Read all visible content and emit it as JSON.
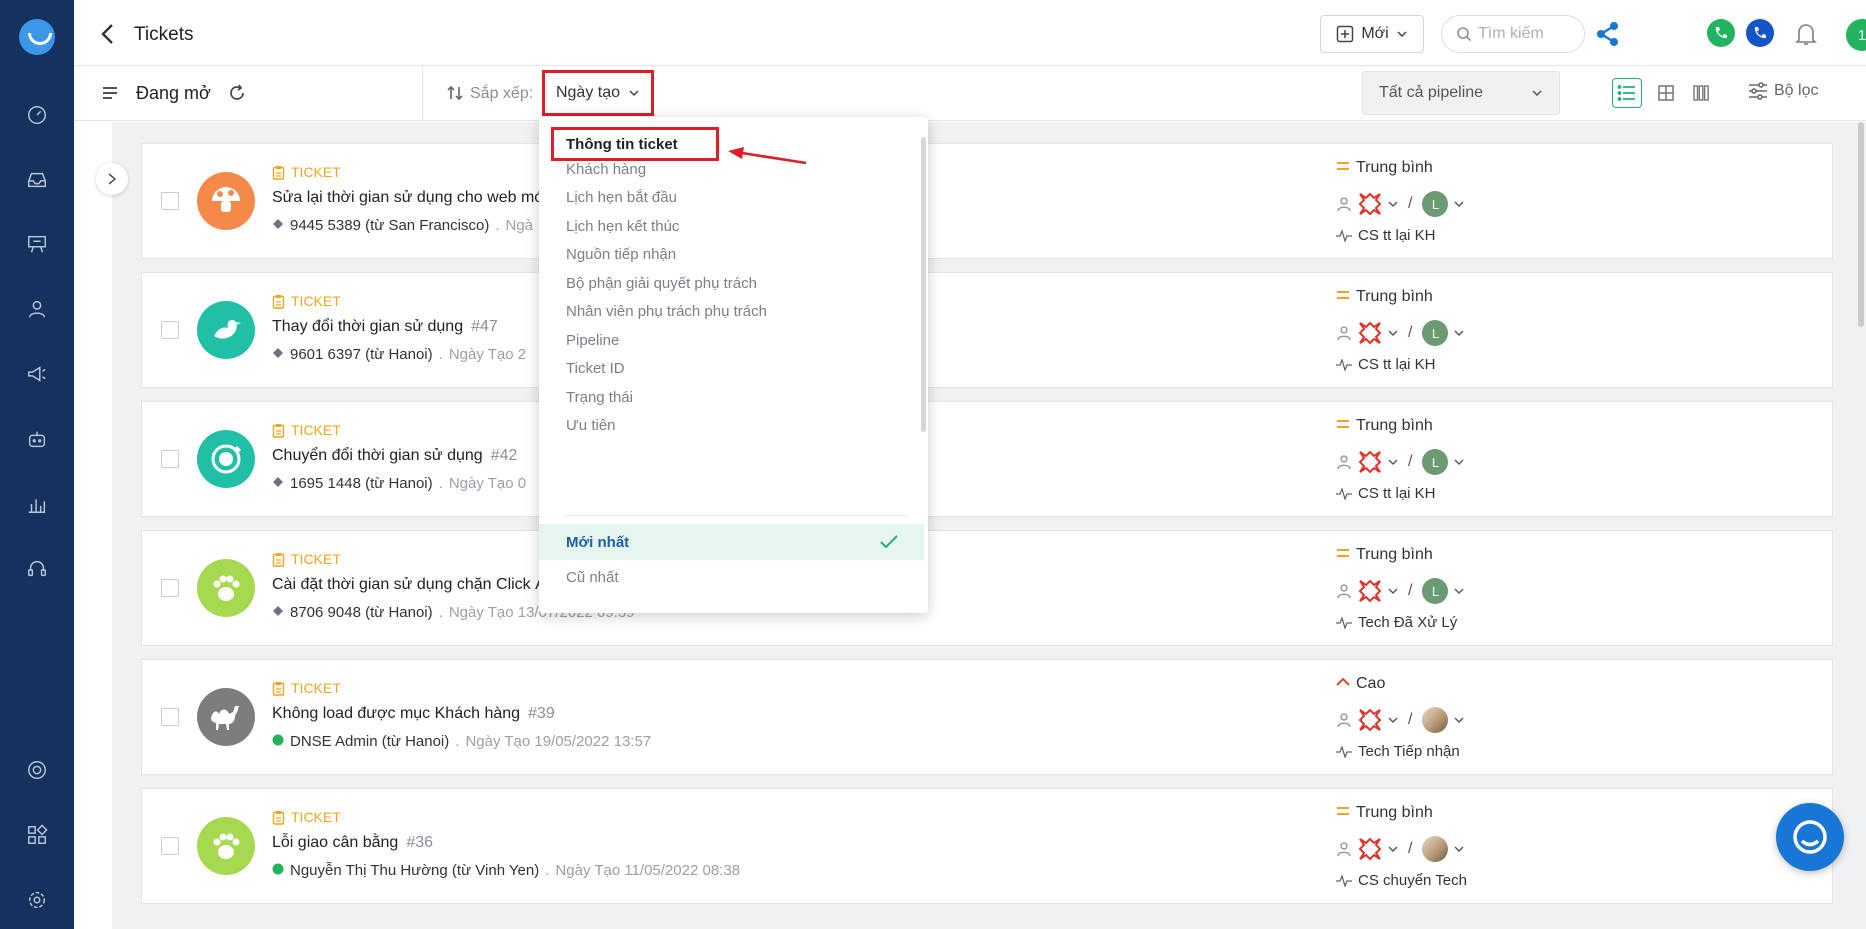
{
  "header": {
    "title": "Tickets",
    "new_label": "Mới",
    "search_placeholder": "Tìm kiếm",
    "user_badge": "1"
  },
  "toolbar": {
    "view_title": "Đang mở",
    "sort_label": "Sắp xếp:",
    "sort_value": "Ngày tạo",
    "pipeline_value": "Tất cả pipeline",
    "filter_label": "Bộ lọc"
  },
  "sort_menu": {
    "fields": [
      "Thông tin ticket",
      "Khách hàng",
      "Lịch hẹn bắt đầu",
      "Lịch hẹn kết thúc",
      "Nguồn tiếp nhận",
      "Bộ phận giải quyết phụ trách",
      "Nhân viên phụ trách phụ trách",
      "Pipeline",
      "Ticket ID",
      "Trạng thái",
      "Ưu tiên"
    ],
    "order": [
      "Mới nhất",
      "Cũ nhất"
    ]
  },
  "tickets": [
    {
      "type": "TICKET",
      "title": "Sửa lại thời gian sử dụng cho web mớ",
      "number": "",
      "meta": "9445 5389 (từ San Francisco)",
      "meta2": "Ngà",
      "priority": "Trung bình",
      "agent_initial": "L",
      "stage": "CS tt lại KH",
      "avatar_color": "#f5894a",
      "avatar_icon": "mushroom-icon",
      "source_icon": "pin-icon"
    },
    {
      "type": "TICKET",
      "title": "Thay đổi thời gian sử dụng",
      "number": "#47",
      "meta": "9601 6397 (từ Hanoi)",
      "meta2": "Ngày Tạo 2",
      "priority": "Trung bình",
      "agent_initial": "L",
      "stage": "CS tt lại KH",
      "avatar_color": "#1fc0a6",
      "avatar_icon": "bird-icon",
      "source_icon": "pin-icon"
    },
    {
      "type": "TICKET",
      "title": "Chuyển đổi thời gian sử dụng",
      "number": "#42",
      "meta": "1695 1448 (từ Hanoi)",
      "meta2": "Ngày Tạo 0",
      "priority": "Trung bình",
      "agent_initial": "L",
      "stage": "CS tt lại KH",
      "avatar_color": "#1fc0a6",
      "avatar_icon": "planet-icon",
      "source_icon": "pin-icon"
    },
    {
      "type": "TICKET",
      "title": "Cài đặt thời gian sử dụng chặn Click Ả",
      "number": "",
      "meta": "8706 9048 (từ Hanoi)",
      "meta2": "Ngày Tạo 13/07/2022 09:39",
      "priority": "Trung bình",
      "agent_initial": "L",
      "stage": "Tech Đã Xử Lý",
      "avatar_color": "#a6d94f",
      "avatar_icon": "paw-icon",
      "source_icon": "pin-icon"
    },
    {
      "type": "TICKET",
      "title": "Không load được mục Khách hàng",
      "number": "#39",
      "meta": "DNSE Admin (từ Hanoi)",
      "meta2": "Ngày Tạo 19/05/2022 13:57",
      "priority": "Cao",
      "agent_initial": "",
      "stage": "Tech Tiếp nhận",
      "avatar_color": "#7d7d7d",
      "avatar_icon": "camel-icon",
      "source_icon": "chat-icon"
    },
    {
      "type": "TICKET",
      "title": "Lỗi giao cân bằng",
      "number": "#36",
      "meta": "Nguyễn Thị Thu Hường (từ Vinh Yen)",
      "meta2": "Ngày Tạo 11/05/2022 08:38",
      "priority": "Trung bình",
      "agent_initial": "",
      "stage": "CS chuyển Tech",
      "avatar_color": "#a6d94f",
      "avatar_icon": "paw-icon",
      "source_icon": "chat-icon"
    }
  ],
  "colors": {
    "nav_bg": "#15315e",
    "accent_green": "#22b073",
    "highlight_red": "#e01e27",
    "ticket_orange": "#f2a41c",
    "priority_high": "#e0462b"
  }
}
